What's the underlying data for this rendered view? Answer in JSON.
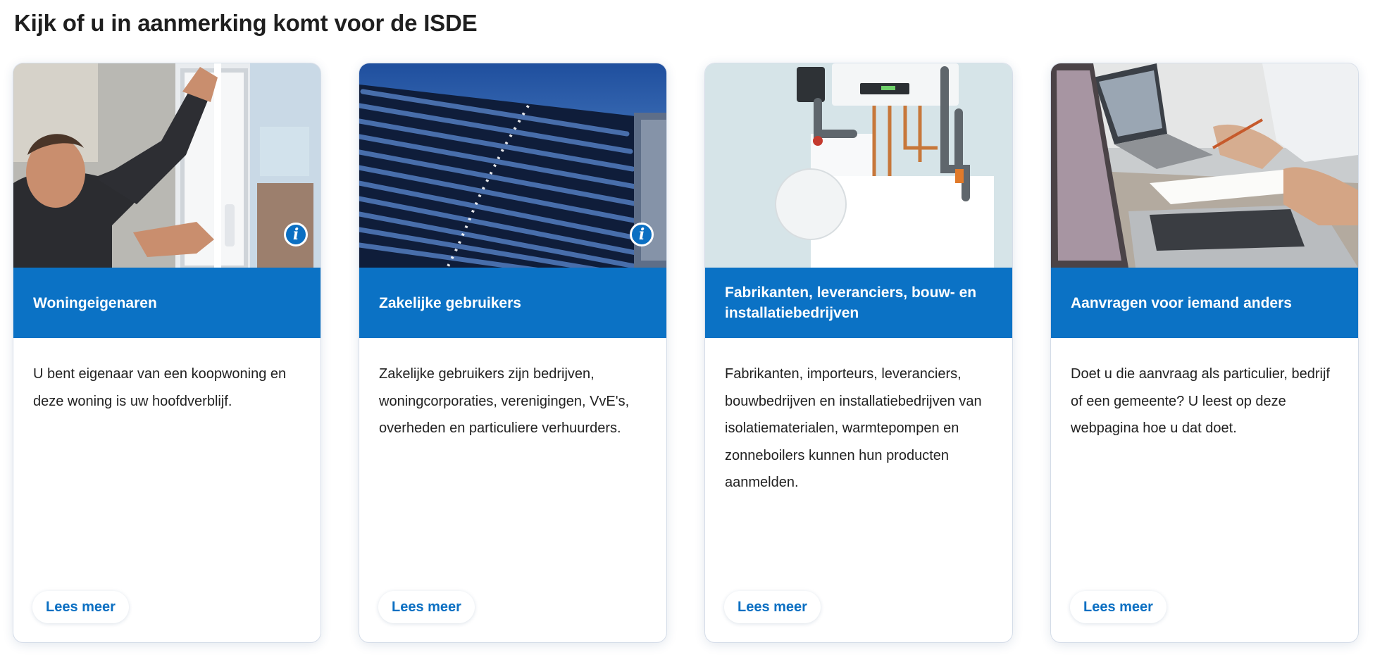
{
  "section": {
    "title": "Kijk of u in aanmerking komt voor de ISDE"
  },
  "cards": [
    {
      "heading": "Woningeigenaren",
      "text": "U bent eigenaar van een koopwoning en deze woning is uw hoofdverblijf.",
      "link": "Lees meer",
      "info_icon": "i"
    },
    {
      "heading": "Zakelijke gebruikers",
      "text": "Zakelijke gebruikers zijn bedrijven, woningcorporaties, verenigingen, VvE's, overheden en particuliere verhuurders.",
      "link": "Lees meer",
      "info_icon": "i"
    },
    {
      "heading": "Fabrikanten, leveranciers, bouw- en installatiebedrijven",
      "text": "Fabrikanten, importeurs, leveranciers, bouwbedrijven en installatiebedrijven van isolatiematerialen, warmtepompen en zonneboilers kunnen hun producten aanmelden.",
      "link": "Lees meer"
    },
    {
      "heading": "Aanvragen voor iemand anders",
      "text": "Doet u die aanvraag als particulier, bedrijf of een gemeente? U leest op deze webpagina hoe u dat doet.",
      "link": "Lees meer"
    }
  ],
  "colors": {
    "accent": "#0b72c5",
    "link": "#0b6fc2",
    "title": "#1f1f1f",
    "text": "#222222"
  }
}
